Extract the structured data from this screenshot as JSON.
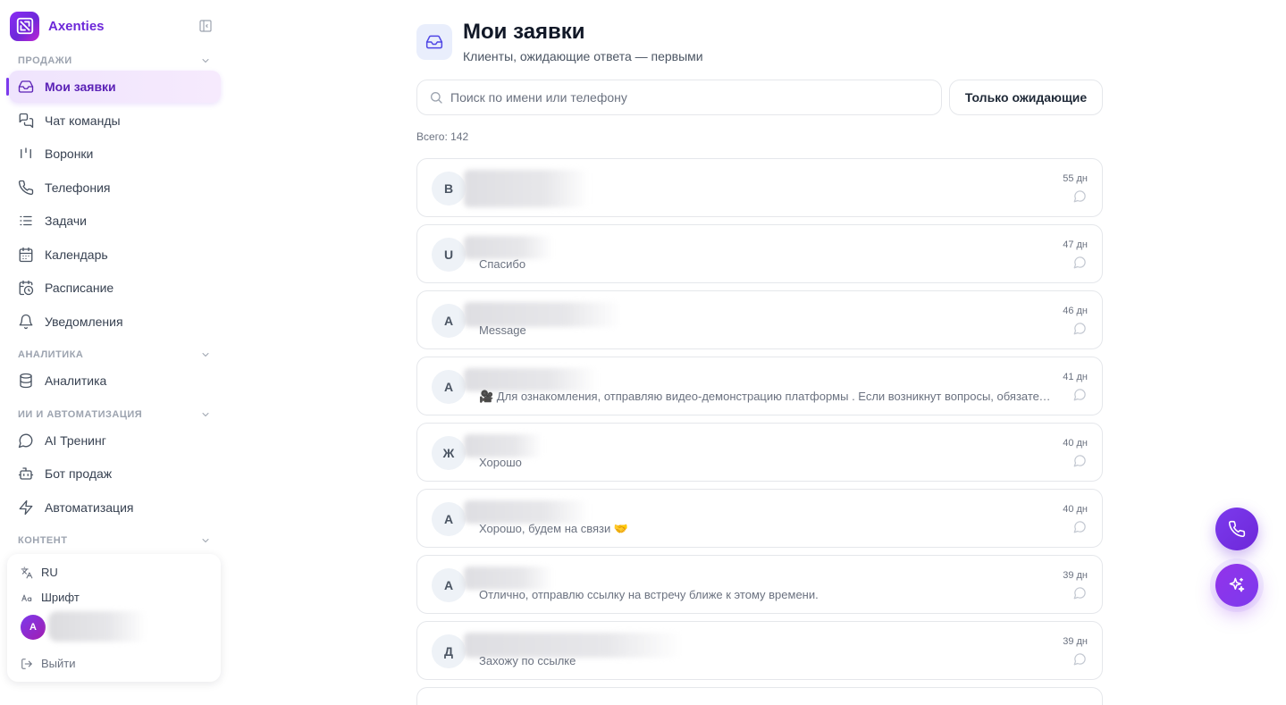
{
  "app": {
    "brand_name": "Axenties",
    "accent_color": "#7c3aed"
  },
  "sidebar": {
    "sections": [
      {
        "title": "ПРОДАЖИ",
        "items": [
          {
            "label": "Мои заявки",
            "icon": "inbox-icon",
            "active": true
          },
          {
            "label": "Чат команды",
            "icon": "chats-icon"
          },
          {
            "label": "Воронки",
            "icon": "kanban-icon"
          },
          {
            "label": "Телефония",
            "icon": "phone-icon"
          },
          {
            "label": "Задачи",
            "icon": "list-icon"
          },
          {
            "label": "Календарь",
            "icon": "calendar-icon"
          },
          {
            "label": "Расписание",
            "icon": "schedule-icon"
          },
          {
            "label": "Уведомления",
            "icon": "bell-icon"
          }
        ]
      },
      {
        "title": "АНАЛИТИКА",
        "items": [
          {
            "label": "Аналитика",
            "icon": "database-icon"
          }
        ]
      },
      {
        "title": "ИИ И АВТОМАТИЗАЦИЯ",
        "items": [
          {
            "label": "AI Тренинг",
            "icon": "message-circle-icon"
          },
          {
            "label": "Бот продаж",
            "icon": "bot-icon"
          },
          {
            "label": "Автоматизация",
            "icon": "lightning-icon"
          }
        ]
      },
      {
        "title": "КОНТЕНТ",
        "items": []
      }
    ],
    "footer": {
      "language": "RU",
      "font_label": "Шрифт",
      "user_initial": "A",
      "logout_label": "Выйти"
    }
  },
  "main": {
    "title": "Мои заявки",
    "subtitle": "Клиенты, ожидающие ответа — первыми",
    "search_placeholder": "Поиск по имени или телефону",
    "filter_label": "Только ожидающие",
    "total_label": "Всего: 142",
    "leads": [
      {
        "initial": "B",
        "message": "",
        "time": "55 дн"
      },
      {
        "initial": "U",
        "message": "Спасибо",
        "time": "47 дн"
      },
      {
        "initial": "A",
        "message": "Message",
        "time": "46 дн"
      },
      {
        "initial": "A",
        "message": "🎥 Для ознакомления, отправляю видео-демонстрацию платформы . Если возникнут вопросы, обязательно пишите",
        "time": "41 дн"
      },
      {
        "initial": "Ж",
        "message": "Хорошо",
        "time": "40 дн"
      },
      {
        "initial": "A",
        "message": "Хорошо, будем на связи 🤝",
        "time": "40 дн"
      },
      {
        "initial": "A",
        "message": "Отлично, отправлю ссылку на встречу ближе к этому времени.",
        "time": "39 дн"
      },
      {
        "initial": "Д",
        "message": "Захожу по ссылке",
        "time": "39 дн"
      }
    ]
  },
  "fabs": {
    "call_icon": "phone-icon",
    "ai_icon": "sparkles-icon"
  }
}
